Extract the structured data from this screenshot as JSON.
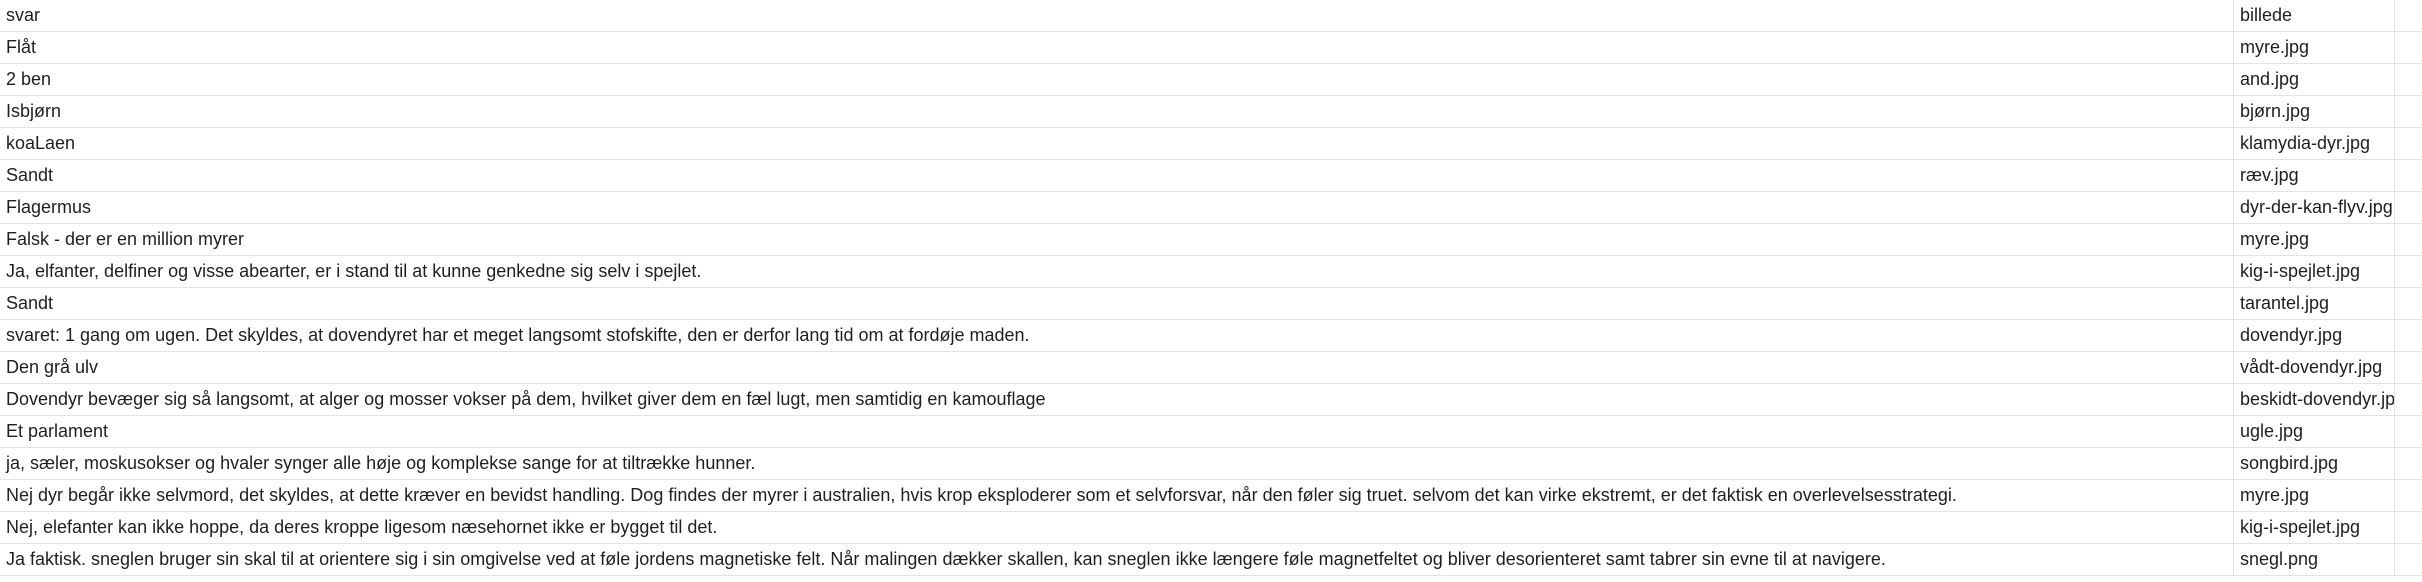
{
  "columns": {
    "svar": "svar",
    "billede": "billede"
  },
  "rows": [
    {
      "svar": "Flåt",
      "billede": "myre.jpg"
    },
    {
      "svar": "2 ben",
      "billede": "and.jpg"
    },
    {
      "svar": "Isbjørn",
      "billede": "bjørn.jpg"
    },
    {
      "svar": "koaLaen",
      "billede": "klamydia-dyr.jpg"
    },
    {
      "svar": "Sandt",
      "billede": "ræv.jpg"
    },
    {
      "svar": "Flagermus",
      "billede": "dyr-der-kan-flyv.jpg"
    },
    {
      "svar": "Falsk - der er en million myrer",
      "billede": "myre.jpg"
    },
    {
      "svar": "Ja, elfanter, delfiner og visse abearter, er i stand til at kunne genkedne sig selv i spejlet.",
      "billede": "kig-i-spejlet.jpg"
    },
    {
      "svar": "Sandt",
      "billede": "tarantel.jpg"
    },
    {
      "svar": "svaret: 1 gang om ugen. Det skyldes, at dovendyret har et meget langsomt stofskifte, den er derfor lang tid om at fordøje maden.",
      "billede": "dovendyr.jpg"
    },
    {
      "svar": "Den grå ulv",
      "billede": "vådt-dovendyr.jpg"
    },
    {
      "svar": "Dovendyr bevæger sig så langsomt, at alger og mosser vokser på dem, hvilket giver dem en fæl lugt, men samtidig en kamouflage",
      "billede": "beskidt-dovendyr.jpg"
    },
    {
      "svar": "Et parlament",
      "billede": "ugle.jpg"
    },
    {
      "svar": "ja, sæler, moskusokser og hvaler synger alle høje og komplekse sange for at tiltrække hunner.",
      "billede": "songbird.jpg"
    },
    {
      "svar": "Nej dyr begår ikke selvmord, det skyldes, at dette kræver en bevidst handling. Dog findes der myrer i australien, hvis krop eksploderer som et selvforsvar, når den føler sig truet. selvom det kan virke ekstremt, er det faktisk en overlevelsesstrategi.",
      "billede": "myre.jpg"
    },
    {
      "svar": "Nej, elefanter kan ikke hoppe, da deres kroppe ligesom næsehornet ikke er bygget til det.",
      "billede": "kig-i-spejlet.jpg"
    },
    {
      "svar": "Ja faktisk. sneglen bruger sin skal til at orientere sig i sin omgivelse ved at føle jordens magnetiske felt. Når malingen dækker skallen, kan sneglen ikke længere føle magnetfeltet og bliver desorienteret samt tabrer sin evne til at navigere.",
      "billede": "snegl.png"
    }
  ]
}
